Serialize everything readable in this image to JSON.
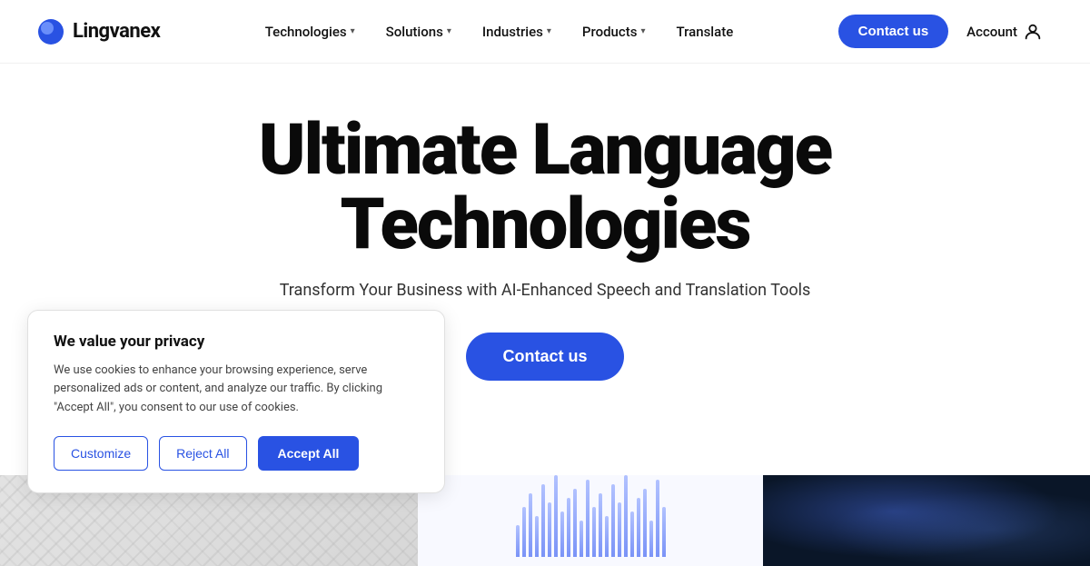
{
  "header": {
    "logo_text": "Lingvanex",
    "nav": {
      "technologies_label": "Technologies",
      "solutions_label": "Solutions",
      "industries_label": "Industries",
      "products_label": "Products",
      "translate_label": "Translate"
    },
    "contact_label": "Contact us",
    "account_label": "Account"
  },
  "hero": {
    "title_line1": "Ultimate Language",
    "title_line2": "Technologies",
    "subtitle": "Transform Your Business with AI-Enhanced Speech and Translation Tools",
    "contact_label": "Contact us"
  },
  "cookie": {
    "title": "We value your privacy",
    "body": "We use cookies to enhance your browsing experience, serve personalized ads or content, and analyze our traffic. By clicking \"Accept All\", you consent to our use of cookies.",
    "customize_label": "Customize",
    "reject_label": "Reject All",
    "accept_label": "Accept All"
  },
  "bars": [
    35,
    55,
    70,
    45,
    80,
    60,
    90,
    50,
    65,
    75,
    40,
    85,
    55,
    70,
    45,
    80,
    60,
    90,
    50,
    65,
    75,
    40,
    85,
    55
  ]
}
